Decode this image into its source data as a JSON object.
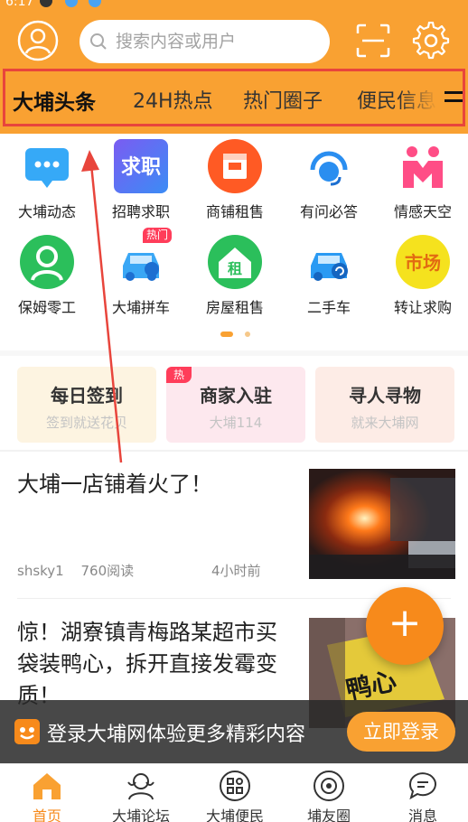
{
  "status": {
    "time": "6:17"
  },
  "header": {
    "search_placeholder": "搜索内容或用户",
    "avatar_icon": "user-avatar-icon",
    "scan_icon": "scan-icon",
    "settings_icon": "gear-icon",
    "bg_color": "#f9a132"
  },
  "tabs": [
    {
      "label": "大埔头条"
    },
    {
      "label": "24H热点"
    },
    {
      "label": "热门圈子"
    },
    {
      "label": "便民信息"
    }
  ],
  "grid": [
    {
      "label": "大埔动态",
      "icon": "chat-bubble-icon",
      "color": "#3aa7f5"
    },
    {
      "label": "招聘求职",
      "icon": "job-icon",
      "color": "#5b6ff2",
      "icon_text": "求职"
    },
    {
      "label": "商铺租售",
      "icon": "shop-icon",
      "color": "#ff5b2a"
    },
    {
      "label": "有问必答",
      "icon": "headset-icon",
      "color": "#2a9af3"
    },
    {
      "label": "情感天空",
      "icon": "heart-people-icon",
      "color": "#ff4d86"
    },
    {
      "label": "保姆零工",
      "icon": "nanny-icon",
      "color": "#2bbf5b"
    },
    {
      "label": "大埔拼车",
      "icon": "carpool-icon",
      "color": "#3aa7f5",
      "badge": "热门"
    },
    {
      "label": "房屋租售",
      "icon": "house-icon",
      "color": "#2bbf5b",
      "icon_text": "租"
    },
    {
      "label": "二手车",
      "icon": "used-car-icon",
      "color": "#2a9af3"
    },
    {
      "label": "转让求购",
      "icon": "market-icon",
      "color": "#f7e22b",
      "icon_text": "市场"
    }
  ],
  "quick_cards": [
    {
      "title": "每日签到",
      "subtitle": "签到就送花贝",
      "bg": "#fdf4e1"
    },
    {
      "title": "商家入驻",
      "subtitle": "大埔114",
      "bg": "#fde8ee",
      "badge": "热"
    },
    {
      "title": "寻人寻物",
      "subtitle": "就来大埔网",
      "bg": "#fdece6"
    }
  ],
  "feed": [
    {
      "title": "大埔一店铺着火了！",
      "author": "shsky1",
      "reads": "760阅读",
      "time": "4小时前"
    },
    {
      "title": "惊！湖寮镇青梅路某超市买袋装鸭心，拆开直接发霉变质！"
    }
  ],
  "fab": {
    "label": "+"
  },
  "login_bar": {
    "text": "登录大埔网体验更多精彩内容",
    "button": "立即登录"
  },
  "bottom_nav": [
    {
      "label": "首页",
      "icon": "home-icon",
      "active": true
    },
    {
      "label": "大埔论坛",
      "icon": "forum-icon"
    },
    {
      "label": "大埔便民",
      "icon": "services-icon"
    },
    {
      "label": "埔友圈",
      "icon": "friends-circle-icon"
    },
    {
      "label": "消息",
      "icon": "message-icon"
    }
  ],
  "colors": {
    "accent": "#f9a132",
    "highlight": "#e8453c",
    "fab": "#f78a1b"
  }
}
